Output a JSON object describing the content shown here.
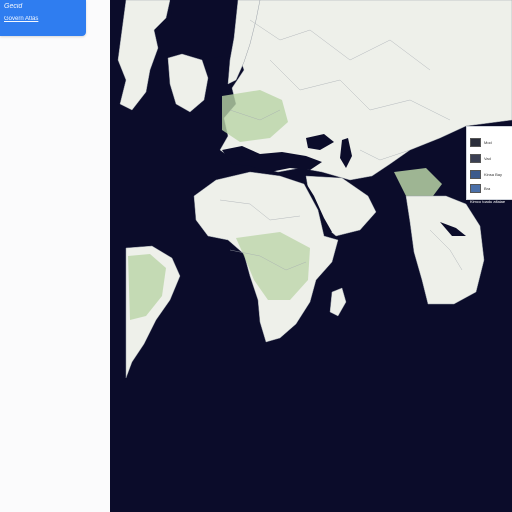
{
  "sidebar": {
    "header_title": "Gecid",
    "header_link": "Govern Atlas"
  },
  "map": {
    "ocean_color": "#0b0c2a",
    "land_color": "#eef0ea",
    "vegetation_color": "#b9d4a6",
    "border_color": "#9aa0a8"
  },
  "layers": [
    {
      "label": "Mod",
      "swatch": "#2a2d3a"
    },
    {
      "label": "Vad",
      "swatch": "#3a3f52"
    },
    {
      "label": "Kinsa Bay",
      "swatch": "#3c5a8c"
    },
    {
      "label": "Bra",
      "swatch": "#4a6fa8"
    }
  ],
  "scale_label": "Kimco toadu aflaiae"
}
